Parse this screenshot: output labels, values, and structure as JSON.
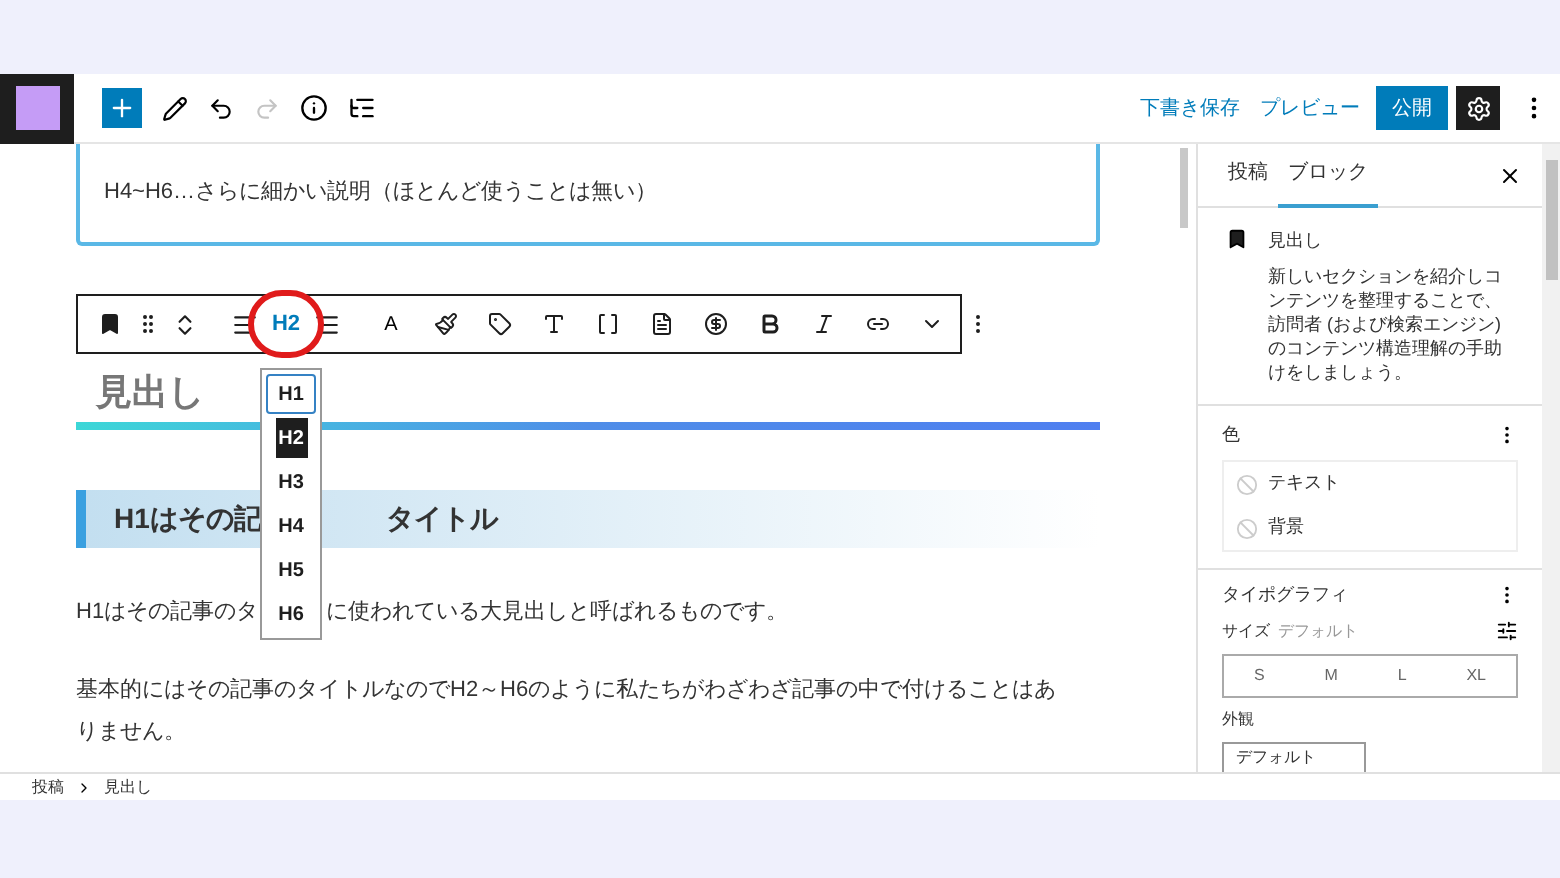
{
  "header": {
    "draft_link": "下書き保存",
    "preview_link": "プレビュー",
    "publish_button": "公開",
    "redo_disabled": true
  },
  "canvas": {
    "callout_text": "H4~H6…さらに細かい説明（ほとんど使うことは無い）",
    "toolbar": {
      "heading_level": "H2",
      "text_color_letter": "A"
    },
    "heading_levels": [
      {
        "label": "H1",
        "selected": false,
        "focused": true
      },
      {
        "label": "H2",
        "selected": true,
        "focused": false
      },
      {
        "label": "H3",
        "selected": false,
        "focused": false
      },
      {
        "label": "H4",
        "selected": false,
        "focused": false
      },
      {
        "label": "H5",
        "selected": false,
        "focused": false
      },
      {
        "label": "H6",
        "selected": false,
        "focused": false
      }
    ],
    "heading_text": "見出し",
    "h2_block": {
      "text_before": "H1はその記",
      "text_after": "タイトル"
    },
    "paragraph_1": {
      "text_before": "H1はその記事のタ",
      "text_after": "に使われている大見出しと呼ばれるものです。"
    },
    "paragraph_2": "基本的にはその記事のタイトルなのでH2～H6のように私たちがわざわざ記事の中で付けることはありません。"
  },
  "sidebar": {
    "tabs": [
      {
        "label": "投稿",
        "selected": false
      },
      {
        "label": "ブロック",
        "selected": true
      }
    ],
    "block_name": "見出し",
    "block_description": "新しいセクションを紹介しコンテンツを整理することで、訪問者 (および検索エンジン) のコンテンツ構造理解の手助けをしましょう。",
    "color_title": "色",
    "color_items": [
      "テキスト",
      "背景"
    ],
    "typography_title": "タイポグラフィ",
    "size_label": "サイズ",
    "size_value": "デフォルト",
    "sizes": [
      {
        "label": "S",
        "selected": false
      },
      {
        "label": "M",
        "selected": false
      },
      {
        "label": "L",
        "selected": false
      },
      {
        "label": "XL",
        "selected": false
      }
    ],
    "appearance_label": "外観",
    "appearance_button": "デフォルト"
  },
  "breadcrumb": [
    "投稿",
    "見出し"
  ]
}
